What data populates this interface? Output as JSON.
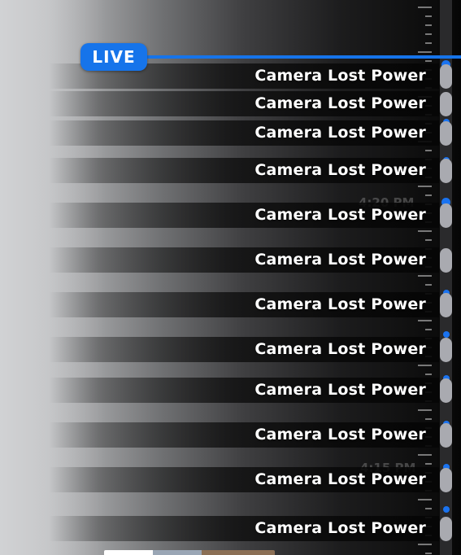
{
  "live_badge": {
    "label": "LIVE",
    "color": "#1674EA"
  },
  "ghost_times": [
    "4:20 PM",
    "4:15 PM"
  ],
  "events": [
    {
      "label": "Camera Lost Power"
    },
    {
      "label": "Camera Lost Power"
    },
    {
      "label": "Camera Lost Power"
    },
    {
      "label": "Camera Lost Power"
    },
    {
      "label": "Camera Lost Power"
    },
    {
      "label": "Camera Lost Power"
    },
    {
      "label": "Camera Lost Power"
    },
    {
      "label": "Camera Lost Power"
    },
    {
      "label": "Camera Lost Power"
    },
    {
      "label": "Camera Lost Power"
    },
    {
      "label": "Camera Lost Power"
    },
    {
      "label": "Camera Lost Power"
    }
  ],
  "colors": {
    "accent": "#1674EA",
    "event_marker": "#A9AAB0"
  }
}
